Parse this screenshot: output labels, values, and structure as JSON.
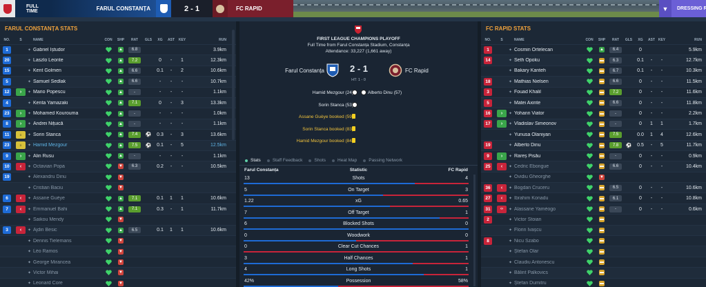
{
  "topbar": {
    "status": "FULL TIME",
    "home_team": "FARUL CONSTANȚA",
    "score": "2 - 1",
    "away_team": "FC RAPID",
    "dressing_room": "DRESSING RO"
  },
  "left": {
    "title": "FARUL CONSTANȚA STATS",
    "headers": [
      "NO.",
      "S",
      "NAME",
      "CON",
      "SHP",
      "RAT",
      "GLS",
      "XG",
      "AST",
      "KEY",
      "RUN"
    ],
    "rows": [
      {
        "no": "1",
        "sub": "",
        "name": "Gabriel Iștudor",
        "con": "green",
        "shp": "up",
        "rat": "6.8",
        "gls": "",
        "xg": "",
        "ast": "",
        "key": "",
        "run": "3.9km",
        "style": ""
      },
      {
        "no": "20",
        "sub": "",
        "name": "Laszlo Leonte",
        "con": "green",
        "shp": "up",
        "rat": "7.2",
        "gls": "",
        "xg": "0",
        "ast": "-",
        "key": "1",
        "run": "12.3km",
        "style": ""
      },
      {
        "no": "15",
        "sub": "",
        "name": "Kent Golmen",
        "con": "green",
        "shp": "up",
        "rat": "6.6",
        "gls": "",
        "xg": "0.1",
        "ast": "-",
        "key": "2",
        "run": "10.6km",
        "style": ""
      },
      {
        "no": "5",
        "sub": "",
        "name": "Samuel Sedlak",
        "con": "green",
        "shp": "up",
        "rat": "6.6",
        "gls": "",
        "xg": "-",
        "ast": "-",
        "key": "-",
        "run": "10.7km",
        "style": ""
      },
      {
        "no": "12",
        "sub": "in",
        "name": "Mario Popescu",
        "con": "green",
        "shp": "up",
        "rat": "-",
        "gls": "",
        "xg": "-",
        "ast": "-",
        "key": "-",
        "run": "1.1km",
        "style": ""
      },
      {
        "no": "4",
        "sub": "",
        "name": "Kenta Yamazaki",
        "con": "green",
        "shp": "up",
        "rat": "7.1",
        "gls": "",
        "xg": "0",
        "ast": "-",
        "key": "3",
        "run": "13.3km",
        "style": ""
      },
      {
        "no": "23",
        "sub": "in",
        "name": "Mohamed Kourouma",
        "con": "green",
        "shp": "up",
        "rat": "-",
        "gls": "",
        "xg": "-",
        "ast": "-",
        "key": "-",
        "run": "1.0km",
        "style": ""
      },
      {
        "no": "8",
        "sub": "in",
        "name": "Andrei Nițuică",
        "con": "green",
        "shp": "up",
        "rat": "-",
        "gls": "",
        "xg": "-",
        "ast": "-",
        "key": "-",
        "run": "1.1km",
        "style": ""
      },
      {
        "no": "11",
        "sub": "cap",
        "name": "Sorin Stanca",
        "con": "green",
        "shp": "up",
        "rat": "7.4",
        "gls": "ball",
        "xg": "0.3",
        "ast": "-",
        "key": "3",
        "run": "13.6km",
        "style": ""
      },
      {
        "no": "23",
        "sub": "cap2",
        "name": "Hamid Mezgour",
        "con": "green",
        "shp": "up",
        "rat": "7.5",
        "gls": "ball",
        "xg": "0.1",
        "ast": "-",
        "key": "5",
        "run": "12.5km",
        "style": "hl"
      },
      {
        "no": "9",
        "sub": "in",
        "name": "Alin Rusu",
        "con": "green",
        "shp": "up",
        "rat": "-",
        "gls": "",
        "xg": "-",
        "ast": "-",
        "key": "-",
        "run": "1.1km",
        "style": ""
      },
      {
        "no": "10",
        "sub": "out",
        "name": "Octavian Popa",
        "con": "green",
        "shp": "down",
        "rat": "6.3",
        "gls": "",
        "xg": "0.2",
        "ast": "-",
        "key": "-",
        "run": "10.5km",
        "style": "dim"
      },
      {
        "no": "19",
        "sub": "",
        "name": "Alexandru Dinu",
        "con": "green",
        "shp": "down",
        "rat": "",
        "gls": "",
        "xg": "",
        "ast": "",
        "key": "",
        "run": "",
        "style": "dim"
      },
      {
        "no": "",
        "sub": "",
        "name": "Cristian Baciu",
        "con": "green",
        "shp": "down",
        "rat": "",
        "gls": "",
        "xg": "",
        "ast": "",
        "key": "",
        "run": "",
        "style": "dim"
      },
      {
        "no": "6",
        "sub": "out",
        "name": "Assane Guèye",
        "con": "green",
        "shp": "up",
        "rat": "7.1",
        "gls": "",
        "xg": "0.1",
        "ast": "1",
        "key": "1",
        "run": "10.6km",
        "style": "dim"
      },
      {
        "no": "7",
        "sub": "out",
        "name": "Emmanuel Bahi",
        "con": "green",
        "shp": "up",
        "rat": "7.1",
        "gls": "",
        "xg": "0.3",
        "ast": "-",
        "key": "1",
        "run": "11.7km",
        "style": "dim"
      },
      {
        "no": "",
        "sub": "",
        "name": "Saikou Mendy",
        "con": "green",
        "shp": "down",
        "rat": "",
        "gls": "",
        "xg": "",
        "ast": "",
        "key": "",
        "run": "",
        "style": "dim"
      },
      {
        "no": "3",
        "sub": "out",
        "name": "Ajdin Besic",
        "con": "green",
        "shp": "up",
        "rat": "6.5",
        "gls": "",
        "xg": "0.1",
        "ast": "1",
        "key": "1",
        "run": "10.6km",
        "style": "dim"
      },
      {
        "no": "",
        "sub": "",
        "name": "Dennis Tielemans",
        "con": "green",
        "shp": "down",
        "rat": "",
        "gls": "",
        "xg": "",
        "ast": "",
        "key": "",
        "run": "",
        "style": "dim"
      },
      {
        "no": "",
        "sub": "",
        "name": "Léo Ramos",
        "con": "green",
        "shp": "down",
        "rat": "",
        "gls": "",
        "xg": "",
        "ast": "",
        "key": "",
        "run": "",
        "style": "dim"
      },
      {
        "no": "",
        "sub": "",
        "name": "George Mirancea",
        "con": "green",
        "shp": "down",
        "rat": "",
        "gls": "",
        "xg": "",
        "ast": "",
        "key": "",
        "run": "",
        "style": "dim"
      },
      {
        "no": "",
        "sub": "",
        "name": "Victor Mihai",
        "con": "green",
        "shp": "down",
        "rat": "",
        "gls": "",
        "xg": "",
        "ast": "",
        "key": "",
        "run": "",
        "style": "dim"
      },
      {
        "no": "",
        "sub": "",
        "name": "Leonard Core",
        "con": "green",
        "shp": "down",
        "rat": "",
        "gls": "",
        "xg": "",
        "ast": "",
        "key": "",
        "run": "",
        "style": "dim"
      }
    ]
  },
  "right": {
    "title": "FC RAPID STATS",
    "headers": [
      "NO.",
      "S",
      "NAME",
      "CON",
      "SHP",
      "RAT",
      "GLS",
      "XG",
      "AST",
      "KEY",
      "RUN"
    ],
    "rows": [
      {
        "no": "1",
        "sub": "",
        "name": "Cosmin Ortelecan",
        "con": "green",
        "shp": "up",
        "rat": "6.4",
        "gls": "",
        "xg": "0",
        "ast": "",
        "key": "",
        "run": "5.9km",
        "style": ""
      },
      {
        "no": "14",
        "sub": "",
        "name": "Seth Opoku",
        "con": "green",
        "shp": "flat",
        "rat": "6.3",
        "gls": "",
        "xg": "0.1",
        "ast": "-",
        "key": "-",
        "run": "12.7km",
        "style": ""
      },
      {
        "no": "",
        "sub": "",
        "name": "Bakary Kanteh",
        "con": "green",
        "shp": "flat",
        "rat": "6.7",
        "gls": "",
        "xg": "0.1",
        "ast": "-",
        "key": "-",
        "run": "10.3km",
        "style": ""
      },
      {
        "no": "18",
        "sub": "",
        "name": "Mathias Nielsen",
        "con": "green",
        "shp": "flat",
        "rat": "6.6",
        "gls": "",
        "xg": "0",
        "ast": "-",
        "key": "-",
        "run": "11.5km",
        "style": ""
      },
      {
        "no": "3",
        "sub": "",
        "name": "Fouad Khalil",
        "con": "green",
        "shp": "flat",
        "rat": "7.2",
        "gls": "",
        "xg": "0",
        "ast": "-",
        "key": "-",
        "run": "11.6km",
        "style": ""
      },
      {
        "no": "5",
        "sub": "",
        "name": "Matei Axinte",
        "con": "green",
        "shp": "flat",
        "rat": "6.6",
        "gls": "",
        "xg": "0",
        "ast": "-",
        "key": "-",
        "run": "11.8km",
        "style": ""
      },
      {
        "no": "16",
        "sub": "in",
        "name": "Yohann Viator",
        "con": "green",
        "shp": "flat",
        "rat": "-",
        "gls": "",
        "xg": "0",
        "ast": "-",
        "key": "-",
        "run": "2.2km",
        "style": ""
      },
      {
        "no": "17",
        "sub": "in",
        "name": "Vladislav Simeonov",
        "con": "green",
        "shp": "flat",
        "rat": "-",
        "gls": "",
        "xg": "0",
        "ast": "1",
        "key": "1",
        "run": "1.7km",
        "style": ""
      },
      {
        "no": "",
        "sub": "",
        "name": "Yunusa Olaniyan",
        "con": "green",
        "shp": "flat",
        "rat": "7.5",
        "gls": "",
        "xg": "0.0",
        "ast": "1",
        "key": "4",
        "run": "12.6km",
        "style": ""
      },
      {
        "no": "19",
        "sub": "",
        "name": "Alberto Dinu",
        "con": "green",
        "shp": "flat",
        "rat": "7.8",
        "gls": "ball",
        "xg": "0.5",
        "ast": "-",
        "key": "5",
        "run": "11.7km",
        "style": ""
      },
      {
        "no": "9",
        "sub": "in",
        "name": "Rareș Pisău",
        "con": "green",
        "shp": "flat",
        "rat": "-",
        "gls": "",
        "xg": "0",
        "ast": "-",
        "key": "-",
        "run": "0.9km",
        "style": ""
      },
      {
        "no": "25",
        "sub": "out",
        "name": "Cedric Ebongue",
        "con": "green",
        "shp": "flat",
        "rat": "6.6",
        "gls": "",
        "xg": "0",
        "ast": "-",
        "key": "-",
        "run": "10.4km",
        "style": "dim"
      },
      {
        "no": "",
        "sub": "",
        "name": "Ovidiu Gheorghe",
        "con": "green",
        "shp": "down",
        "rat": "",
        "gls": "",
        "xg": "",
        "ast": "",
        "key": "",
        "run": "",
        "style": "dim"
      },
      {
        "no": "36",
        "sub": "out",
        "name": "Bogdan Cruceru",
        "con": "green",
        "shp": "flat",
        "rat": "6.5",
        "gls": "",
        "xg": "0",
        "ast": "-",
        "key": "-",
        "run": "10.6km",
        "style": "dim"
      },
      {
        "no": "27",
        "sub": "out",
        "name": "Ibrahim Konadu",
        "con": "green",
        "shp": "flat",
        "rat": "6.1",
        "gls": "",
        "xg": "0",
        "ast": "-",
        "key": "-",
        "run": "10.8km",
        "style": "dim"
      },
      {
        "no": "31",
        "sub": "both",
        "name": "Alassane Yaméogo",
        "con": "green",
        "shp": "flat",
        "rat": "-",
        "gls": "",
        "xg": "0",
        "ast": "-",
        "key": "-",
        "run": "0.6km",
        "style": "dim"
      },
      {
        "no": "2",
        "sub": "",
        "name": "Victor Stoian",
        "con": "green",
        "shp": "flat",
        "rat": "",
        "gls": "",
        "xg": "",
        "ast": "",
        "key": "",
        "run": "",
        "style": "dim"
      },
      {
        "no": "",
        "sub": "",
        "name": "Florin Ivașcu",
        "con": "green",
        "shp": "flat",
        "rat": "",
        "gls": "",
        "xg": "",
        "ast": "",
        "key": "",
        "run": "",
        "style": "dim"
      },
      {
        "no": "8",
        "sub": "",
        "name": "Nicu Szabo",
        "con": "green",
        "shp": "flat",
        "rat": "",
        "gls": "",
        "xg": "",
        "ast": "",
        "key": "",
        "run": "",
        "style": "dim"
      },
      {
        "no": "",
        "sub": "",
        "name": "Ștefan Olar",
        "con": "green",
        "shp": "flat",
        "rat": "",
        "gls": "",
        "xg": "",
        "ast": "",
        "key": "",
        "run": "",
        "style": "dim"
      },
      {
        "no": "",
        "sub": "",
        "name": "Claudiu Antonescu",
        "con": "green",
        "shp": "flat",
        "rat": "",
        "gls": "",
        "xg": "",
        "ast": "",
        "key": "",
        "run": "",
        "style": "dim"
      },
      {
        "no": "",
        "sub": "",
        "name": "Bălint Palkovics",
        "con": "green",
        "shp": "flat",
        "rat": "",
        "gls": "",
        "xg": "",
        "ast": "",
        "key": "",
        "run": "",
        "style": "dim"
      },
      {
        "no": "",
        "sub": "",
        "name": "Ștefan Dumitru",
        "con": "green",
        "shp": "flat",
        "rat": "",
        "gls": "",
        "xg": "",
        "ast": "",
        "key": "",
        "run": "",
        "style": "dim"
      }
    ]
  },
  "center": {
    "competition": "FIRST LEAGUE CHAMPIONS PLAYOFF",
    "venue": "Full Time from Farul Constanța Stadium, Constanța",
    "attendance": "Attendance: 33,227 (1,661 away)",
    "home": "Farul Constanța",
    "away": "FC Rapid",
    "score": "2 - 1",
    "ht": "HT: 1 - 0",
    "events": [
      {
        "side": "home",
        "text": "Hamid Mezgour (24)",
        "icon": "ball",
        "away_text": "Alberto Dinu (57)"
      },
      {
        "side": "home",
        "text": "Sorin Stanca (53)",
        "icon": "ball",
        "away_text": ""
      },
      {
        "side": "home",
        "text": "Assane Guèye booked (59)",
        "icon": "card",
        "away_text": ""
      },
      {
        "side": "home",
        "text": "Sorin Stanca booked (83)",
        "icon": "card",
        "away_text": ""
      },
      {
        "side": "home",
        "text": "Hamid Mezgour booked (84)",
        "icon": "card",
        "away_text": ""
      }
    ],
    "tabs": [
      "Stats",
      "Staff Feedback",
      "Shots",
      "Heat Map",
      "Passing Network"
    ],
    "stats_header": {
      "home": "Farul Constanța",
      "label": "Statistic",
      "away": "FC Rapid"
    },
    "stats": [
      {
        "label": "Shots",
        "home": "13",
        "away": "4",
        "home_share": 0.76
      },
      {
        "label": "On Target",
        "home": "5",
        "away": "3",
        "home_share": 0.62
      },
      {
        "label": "xG",
        "home": "1.22",
        "away": "0.65",
        "home_share": 0.65
      },
      {
        "label": "Off Target",
        "home": "7",
        "away": "1",
        "home_share": 0.87
      },
      {
        "label": "Blocked Shots",
        "home": "6",
        "away": "0",
        "home_share": 1.0
      },
      {
        "label": "Woodwork",
        "home": "0",
        "away": "0",
        "home_share": 0.5
      },
      {
        "label": "Clear Cut Chances",
        "home": "0",
        "away": "1",
        "home_share": 0.0
      },
      {
        "label": "Half Chances",
        "home": "3",
        "away": "1",
        "home_share": 0.75
      },
      {
        "label": "Long Shots",
        "home": "4",
        "away": "1",
        "home_share": 0.8
      },
      {
        "label": "Possession",
        "home": "42%",
        "away": "58%",
        "home_share": 0.42
      }
    ]
  }
}
